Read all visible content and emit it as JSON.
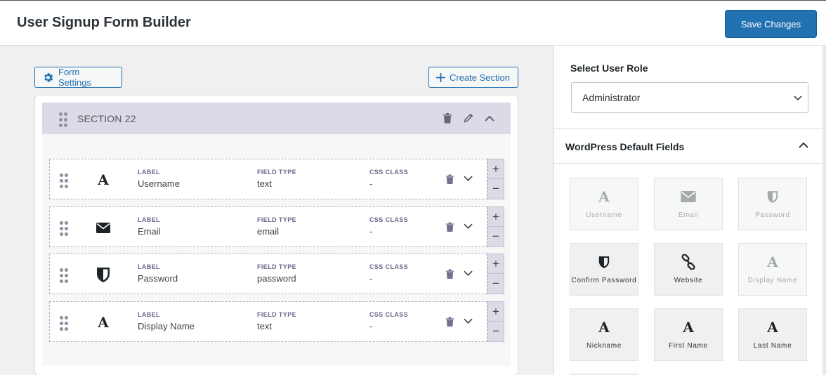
{
  "header": {
    "title": "User Signup Form Builder",
    "save_label": "Save Changes"
  },
  "toolbar": {
    "form_settings_label": "Form Settings",
    "create_section_label": "Create Section"
  },
  "section": {
    "title": "SECTION 22",
    "column_headers": {
      "label": "LABEL",
      "field_type": "FIELD TYPE",
      "css_class": "CSS CLASS"
    },
    "fields": [
      {
        "icon": "text-a-icon",
        "label": "Username",
        "field_type": "text",
        "css_class": "-"
      },
      {
        "icon": "envelope-icon",
        "label": "Email",
        "field_type": "email",
        "css_class": "-"
      },
      {
        "icon": "shield-icon",
        "label": "Password",
        "field_type": "password",
        "css_class": "-"
      },
      {
        "icon": "text-a-icon",
        "label": "Display Name",
        "field_type": "text",
        "css_class": "-"
      }
    ],
    "plus": "+",
    "minus": "−"
  },
  "sidebar": {
    "role_label": "Select User Role",
    "role_value": "Administrator",
    "wp_fields_title": "WordPress Default Fields",
    "tiles": [
      {
        "label": "Username",
        "icon": "text-a-icon",
        "glyph": "A",
        "enabled": false
      },
      {
        "label": "Email",
        "icon": "envelope-icon",
        "glyph": "",
        "enabled": false
      },
      {
        "label": "Password",
        "icon": "shield-icon",
        "glyph": "",
        "enabled": false
      },
      {
        "label": "Confirm Password",
        "icon": "shield-icon",
        "glyph": "",
        "enabled": true
      },
      {
        "label": "Website",
        "icon": "link-icon",
        "glyph": "",
        "enabled": true
      },
      {
        "label": "Display Name",
        "icon": "text-a-icon",
        "glyph": "A",
        "enabled": false
      },
      {
        "label": "Nickname",
        "icon": "text-a-icon",
        "glyph": "A",
        "enabled": true
      },
      {
        "label": "First Name",
        "icon": "text-a-icon",
        "glyph": "A",
        "enabled": true
      },
      {
        "label": "Last Name",
        "icon": "text-a-icon",
        "glyph": "A",
        "enabled": true
      }
    ]
  },
  "colors": {
    "primary": "#2271b1",
    "section_header": "#dcdae6",
    "muted_label": "#6b6789"
  }
}
